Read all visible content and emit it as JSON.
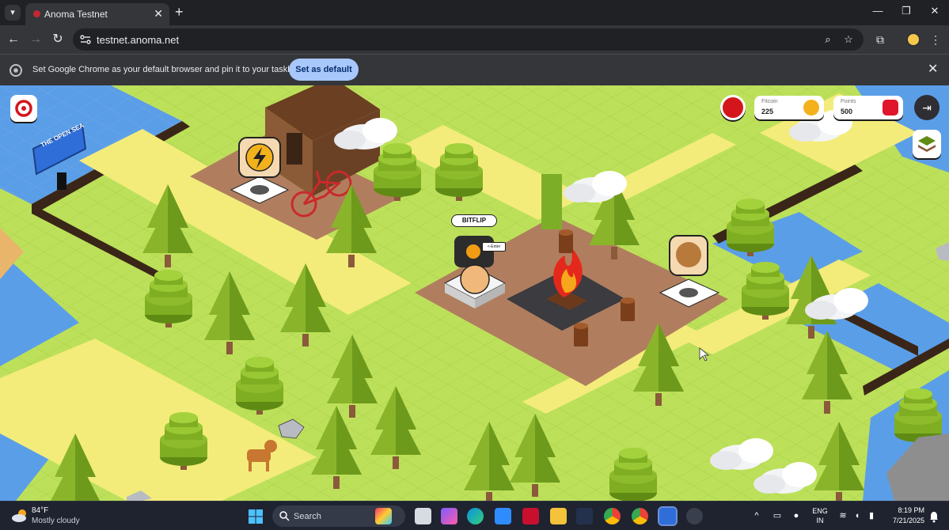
{
  "browser": {
    "tab": {
      "title": "Anoma Testnet"
    },
    "address": "testnet.anoma.net",
    "infobar": {
      "message": "Set Google Chrome as your default browser and pin it to your taskbar",
      "button_label": "Set as default"
    }
  },
  "game": {
    "sign_text": "THE OPEN SEA",
    "npc_tag": "BITFLIP",
    "enter_hint": "<-Enter",
    "hud": {
      "fitcoin": {
        "label": "Fitcoin",
        "value": "225"
      },
      "points": {
        "label": "Points",
        "value": "500"
      }
    }
  },
  "taskbar": {
    "weather": {
      "temp": "84°F",
      "desc": "Mostly cloudy"
    },
    "search_placeholder": "Search",
    "language": {
      "line1": "ENG",
      "line2": "IN"
    },
    "clock": {
      "time": "8:19 PM",
      "date": "7/21/2025"
    }
  },
  "icons": [
    "tab-search-icon",
    "close-icon",
    "new-tab-icon",
    "minimize-icon",
    "maximize-icon",
    "back-icon",
    "forward-icon",
    "reload-icon",
    "site-settings-icon",
    "zoom-icon",
    "bookmark-star-icon",
    "extensions-icon",
    "menu-dots-icon",
    "chrome-logo-icon",
    "lightning-icon",
    "shiba-coin-icon",
    "campfire-icon",
    "windows-start-icon"
  ]
}
